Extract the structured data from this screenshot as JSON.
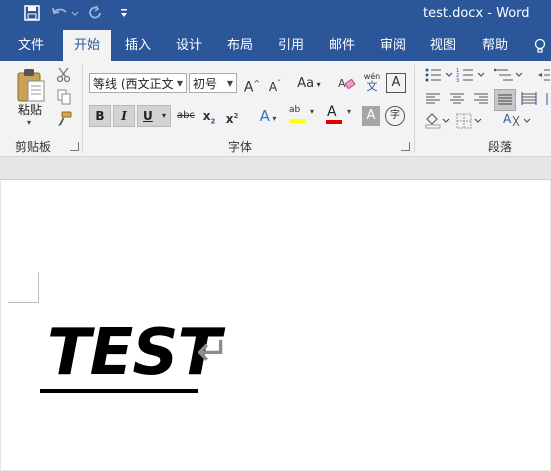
{
  "titlebar": {
    "doc_title": "test.docx  -  Word",
    "qat": {
      "save_icon": "save-icon",
      "undo_icon": "undo-icon",
      "redo_icon": "redo-icon",
      "customize_icon": "chevron-down-icon"
    }
  },
  "tabs": [
    {
      "label": "文件"
    },
    {
      "label": "开始",
      "active": true
    },
    {
      "label": "插入"
    },
    {
      "label": "设计"
    },
    {
      "label": "布局"
    },
    {
      "label": "引用"
    },
    {
      "label": "邮件"
    },
    {
      "label": "审阅"
    },
    {
      "label": "视图"
    },
    {
      "label": "帮助"
    }
  ],
  "ribbon": {
    "clipboard": {
      "paste_label": "粘贴",
      "group_label": "剪贴板"
    },
    "font": {
      "font_name": "等线 (西文正文",
      "font_size": "初号",
      "grow_font": "A",
      "shrink_font": "A",
      "change_case": "Aa",
      "wen_label": "wén",
      "wen_char": "文",
      "char_border": "A",
      "bold": "B",
      "italic": "I",
      "underline": "U",
      "strikethrough": "abc",
      "subscript": "x",
      "superscript": "x",
      "text_effects": "A",
      "highlight": "ab",
      "font_color": "A",
      "char_shading": "A",
      "enclosed_char": "字",
      "group_label": "字体"
    },
    "paragraph": {
      "group_label": "段落"
    }
  },
  "document": {
    "text": "TEST",
    "paragraph_mark": "↵"
  },
  "colors": {
    "accent": "#2b579a",
    "ribbon_bg": "#f3f3f3",
    "highlight_yellow": "#ffff00",
    "font_color_red": "#e00000"
  }
}
